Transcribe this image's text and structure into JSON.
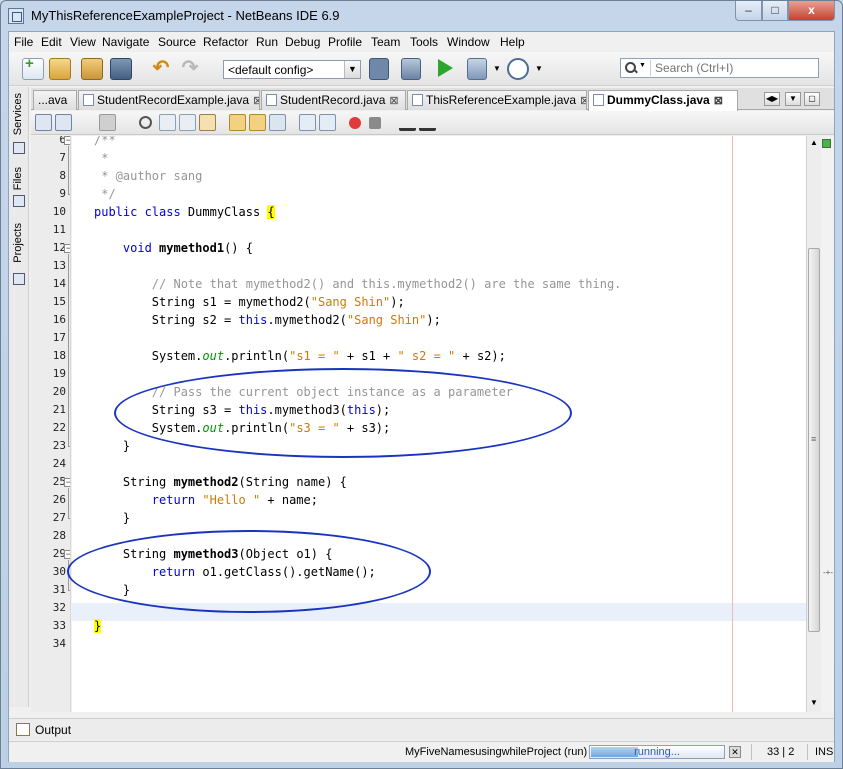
{
  "window": {
    "title": "MyThisReferenceExampleProject - NetBeans IDE 6.9",
    "minimize": "–",
    "maximize": "□",
    "close": "x"
  },
  "menu": [
    "File",
    "Edit",
    "View",
    "Navigate",
    "Source",
    "Refactor",
    "Run",
    "Debug",
    "Profile",
    "Team",
    "Tools",
    "Window",
    "Help"
  ],
  "toolbar": {
    "config_value": "<default config>",
    "search_placeholder": "Search (Ctrl+I)"
  },
  "side_tabs": [
    "Services",
    "Files",
    "Projects"
  ],
  "editor_tabs": [
    {
      "label": "...ava"
    },
    {
      "label": "StudentRecordExample.java"
    },
    {
      "label": "StudentRecord.java"
    },
    {
      "label": "ThisReferenceExample.java"
    },
    {
      "label": "DummyClass.java",
      "active": true
    }
  ],
  "code": {
    "lines": [
      6,
      7,
      8,
      9,
      10,
      11,
      12,
      13,
      14,
      15,
      16,
      17,
      18,
      19,
      20,
      21,
      22,
      23,
      24,
      25,
      26,
      27,
      28,
      29,
      30,
      31,
      32,
      33,
      34
    ]
  },
  "output_label": "Output",
  "status": {
    "project": "MyFiveNamesusingwhileProject (run)",
    "progress_text": "running...",
    "progress_fraction": 0.35,
    "position": "33 | 2",
    "mode": "INS"
  },
  "colors": {
    "keyword": "#0000e6",
    "string": "#ce7b00",
    "comment": "#969696",
    "annotation_ellipse": "#1a34c0"
  }
}
